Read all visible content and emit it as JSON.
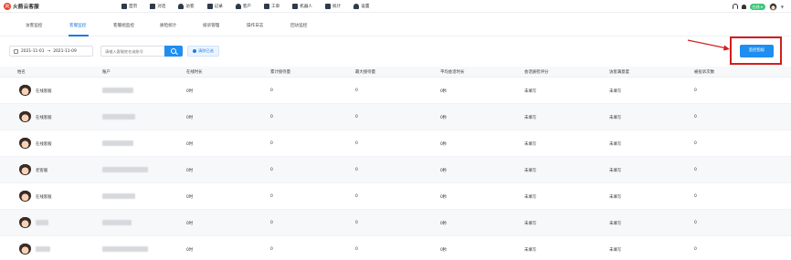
{
  "brand": {
    "logo_glyph": "火",
    "name": "火箭云客服"
  },
  "nav": [
    {
      "label": "首页",
      "icon": "home-icon"
    },
    {
      "label": "对话",
      "icon": "chat-icon"
    },
    {
      "label": "访客",
      "icon": "visitors-icon"
    },
    {
      "label": "记录",
      "icon": "records-icon"
    },
    {
      "label": "客户",
      "icon": "customer-icon"
    },
    {
      "label": "工单",
      "icon": "ticket-icon"
    },
    {
      "label": "机器人",
      "icon": "robot-icon"
    },
    {
      "label": "统计",
      "icon": "stats-icon"
    },
    {
      "label": "设置",
      "icon": "settings-icon"
    }
  ],
  "user_status": "在线",
  "tabs": [
    "访客监控",
    "客服监控",
    "客服组监控",
    "质检统计",
    "投诉管理",
    "操作日志",
    "回访监控"
  ],
  "active_tab_index": 1,
  "filters": {
    "date_start": "2021-11-01",
    "date_sep": "→",
    "date_end": "2021-11-09",
    "search_placeholder": "请输入客服姓名或账号",
    "clear_label": "清除已选"
  },
  "monitor_button_label": "监控指标",
  "table": {
    "columns": [
      "姓名",
      "账户",
      "在线时长",
      "累计接待量",
      "最大接待量",
      "平均会话时长",
      "会话质检评分",
      "访客满意度",
      "被投诉次数"
    ],
    "rows": [
      {
        "name": "在线客服",
        "online": "0时",
        "total": "0",
        "max": "0",
        "avg": "0秒",
        "score": "未填写",
        "satisfaction": "未填写",
        "complaints": "0"
      },
      {
        "name": "在线客服",
        "online": "0时",
        "total": "0",
        "max": "0",
        "avg": "0秒",
        "score": "未填写",
        "satisfaction": "未填写",
        "complaints": "0"
      },
      {
        "name": "在线客服",
        "online": "0时",
        "total": "0",
        "max": "0",
        "avg": "0秒",
        "score": "未填写",
        "satisfaction": "未填写",
        "complaints": "0"
      },
      {
        "name": "老客服",
        "online": "0时",
        "total": "0",
        "max": "0",
        "avg": "0秒",
        "score": "未填写",
        "satisfaction": "未填写",
        "complaints": "0"
      },
      {
        "name": "在线客服",
        "online": "0时",
        "total": "0",
        "max": "0",
        "avg": "0秒",
        "score": "未填写",
        "satisfaction": "未填写",
        "complaints": "0"
      },
      {
        "name": "",
        "online": "0时",
        "total": "0",
        "max": "0",
        "avg": "0秒",
        "score": "未填写",
        "satisfaction": "未填写",
        "complaints": "0"
      },
      {
        "name": "",
        "online": "0时",
        "total": "0",
        "max": "0",
        "avg": "0秒",
        "score": "未填写",
        "satisfaction": "未填写",
        "complaints": "0"
      }
    ]
  },
  "colors": {
    "accent": "#1f8ef1",
    "annotation": "#d21e1e",
    "status": "#3ec87a"
  }
}
